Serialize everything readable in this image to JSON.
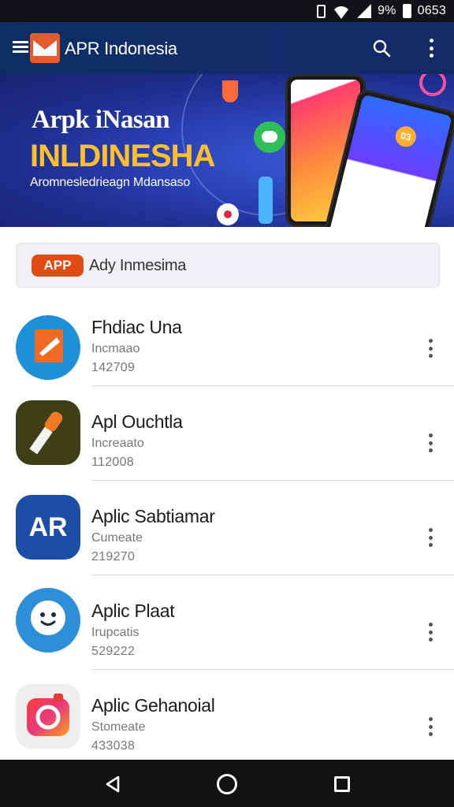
{
  "status_bar": {
    "battery_percent": "9%",
    "time": "0653"
  },
  "app_bar": {
    "title": "APR Indonesia",
    "icons": [
      "menu-icon",
      "app-logo",
      "search-icon",
      "more-vert-icon"
    ]
  },
  "banner": {
    "title_line1": "Arpk iNasan",
    "title_line2": "INLDINESHA",
    "subtitle": "Aromnesledrieagn Mdansaso",
    "phone_badge": "03"
  },
  "filter_bar": {
    "badge": "APP",
    "label": "Ady Inmesima"
  },
  "apps": [
    {
      "title": "Fhdiac Una",
      "subtitle": "Incmaao",
      "meta": "142709",
      "icon": "megaphone-icon",
      "icon_bg": "#1f8fd8"
    },
    {
      "title": "Apl Ouchtla",
      "subtitle": "Increaato",
      "meta": "112008",
      "icon": "microphone-icon",
      "icon_bg": "#3d4017"
    },
    {
      "title": "Aplic Sabtiamar",
      "subtitle": "Cumeate",
      "meta": "219270",
      "icon": "ar-letters-icon",
      "icon_bg": "#1d4ea5",
      "icon_text": "AR"
    },
    {
      "title": "Aplic Plaat",
      "subtitle": "Irupcatis",
      "meta": "529222",
      "icon": "smiley-chat-icon",
      "icon_bg": "#2e8fd8"
    },
    {
      "title": "Aplic Gehanoial",
      "subtitle": "Stomeate",
      "meta": "433038",
      "icon": "camera-icon",
      "icon_bg": "#eeeeee"
    }
  ],
  "nav_bar": {
    "icons": [
      "back-icon",
      "home-icon",
      "recents-icon"
    ]
  }
}
